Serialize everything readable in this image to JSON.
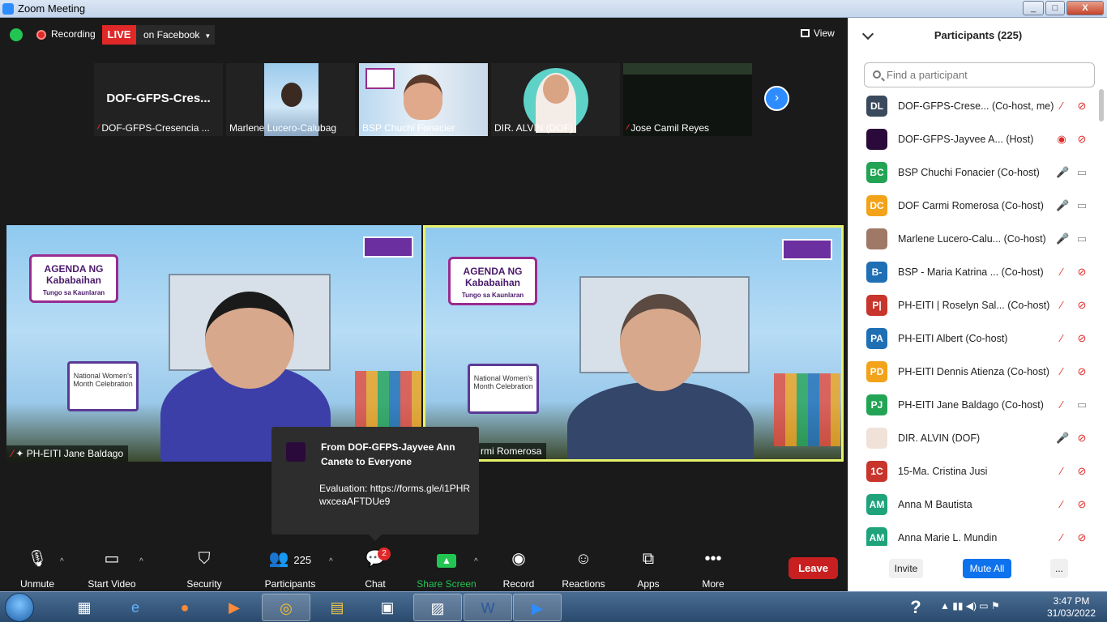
{
  "window": {
    "title": "Zoom Meeting",
    "min": "_",
    "max": "□",
    "close": "X"
  },
  "topbar": {
    "recording": "Recording",
    "live": "LIVE",
    "destination": "on Facebook",
    "view": "View"
  },
  "thumbnails": [
    {
      "big": "DOF-GFPS-Cres...",
      "name": "DOF-GFPS-Cresencia ...",
      "muted": true
    },
    {
      "name": "Marlene Lucero-Calubag",
      "muted": false
    },
    {
      "name": "BSP Chuchi Fonacier",
      "muted": false
    },
    {
      "name": "DIR. ALVIN (DOF)",
      "muted": false
    },
    {
      "name": "Jose Camil Reyes",
      "muted": true
    }
  ],
  "tiles": [
    {
      "name": "PH-EITI Jane Baldago",
      "agenda_line1": "AGENDA NG",
      "agenda_line2": "Kababaihan",
      "agenda_line3": "Tungo sa Kaunlaran",
      "board": "National Women's Month Celebration"
    },
    {
      "name": "rmi Romerosa",
      "agenda_line1": "AGENDA NG",
      "agenda_line2": "Kababaihan",
      "agenda_line3": "Tungo sa Kaunlaran",
      "board": "National Women's Month Celebration"
    }
  ],
  "chat_toast": {
    "header": "From DOF-GFPS-Jayvee Ann Canete to Everyone",
    "message": "Evaluation: https://forms.gle/i1PHRwxceaAFTDUe9"
  },
  "toolbar": {
    "unmute": "Unmute",
    "start_video": "Start Video",
    "security": "Security",
    "participants": "Participants",
    "participants_count": "225",
    "chat": "Chat",
    "chat_badge": "2",
    "share_screen": "Share Screen",
    "record": "Record",
    "reactions": "Reactions",
    "apps": "Apps",
    "more": "More",
    "leave": "Leave"
  },
  "panel": {
    "title": "Participants (225)",
    "search_placeholder": "Find a participant",
    "invite": "Invite",
    "mute_all": "Mute All",
    "more": "...",
    "participants": [
      {
        "initials": "DL",
        "color": "#3a4a5c",
        "name": "DOF-GFPS-Crese... (Co-host, me)",
        "mic": "off",
        "cam": "off"
      },
      {
        "initials": "",
        "color": "#2a0a3a",
        "name": "DOF-GFPS-Jayvee A... (Host)",
        "mic": "rec",
        "cam": "off"
      },
      {
        "initials": "BC",
        "color": "#23a455",
        "name": "BSP Chuchi Fonacier (Co-host)",
        "mic": "on",
        "cam": "on"
      },
      {
        "initials": "DC",
        "color": "#f2a31a",
        "name": "DOF Carmi Romerosa (Co-host)",
        "mic": "on",
        "cam": "on"
      },
      {
        "initials": "",
        "color": "#a07866",
        "name": "Marlene Lucero-Calu... (Co-host)",
        "mic": "on",
        "cam": "on"
      },
      {
        "initials": "B-",
        "color": "#1f6fb5",
        "name": "BSP - Maria Katrina ... (Co-host)",
        "mic": "off",
        "cam": "off"
      },
      {
        "initials": "P|",
        "color": "#c8352d",
        "name": "PH-EITI | Roselyn Sal... (Co-host)",
        "mic": "off",
        "cam": "off"
      },
      {
        "initials": "PA",
        "color": "#1f6fb5",
        "name": "PH-EITI Albert (Co-host)",
        "mic": "off",
        "cam": "off"
      },
      {
        "initials": "PD",
        "color": "#f2a31a",
        "name": "PH-EITI Dennis Atienza (Co-host)",
        "mic": "off",
        "cam": "off"
      },
      {
        "initials": "PJ",
        "color": "#23a455",
        "name": "PH-EITI Jane Baldago (Co-host)",
        "mic": "off",
        "cam": "on"
      },
      {
        "initials": "",
        "color": "#f0e2d8",
        "name": "DIR. ALVIN (DOF)",
        "mic": "on",
        "cam": "off"
      },
      {
        "initials": "1C",
        "color": "#c8352d",
        "name": "15-Ma. Cristina Jusi",
        "mic": "off",
        "cam": "off"
      },
      {
        "initials": "AM",
        "color": "#1fa37a",
        "name": "Anna M Bautista",
        "mic": "off",
        "cam": "off"
      },
      {
        "initials": "AM",
        "color": "#1fa37a",
        "name": "Anna Marie L. Mundin",
        "mic": "off",
        "cam": "off"
      }
    ]
  },
  "taskbar": {
    "time": "3:47 PM",
    "date": "31/03/2022",
    "help": "?"
  }
}
